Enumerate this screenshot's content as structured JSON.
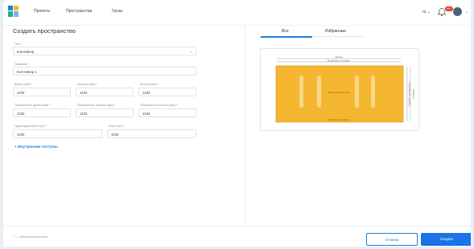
{
  "header": {
    "nav": [
      "Проекты",
      "Пространства",
      "Грузы"
    ],
    "lang": "ru",
    "notification_count": "99+"
  },
  "form": {
    "title": "Создать пространство",
    "type": {
      "label": "Тип",
      "value": "Контейнер"
    },
    "name": {
      "label": "Название",
      "value": "Контейнер 1"
    },
    "length": {
      "label": "Длина (мм)",
      "value": "1234"
    },
    "width": {
      "label": "Ширина (мм)",
      "value": "1234"
    },
    "height": {
      "label": "Высота (мм)",
      "value": "1234"
    },
    "length_error": {
      "label": "Погрешность длины (мм)",
      "value": "1234"
    },
    "width_error": {
      "label": "Погрешность ширины (мм)",
      "value": "1234"
    },
    "height_error": {
      "label": "Погрешность высоты (мм)",
      "value": "1234"
    },
    "capacity": {
      "label": "Грузоподъёмность (кг)",
      "value": "1234"
    },
    "mass": {
      "label": "Масса (кг)",
      "value": "1234"
    },
    "advanced": "Внутренние отступы"
  },
  "preview": {
    "tabs": [
      "Все",
      "Избранные"
    ],
    "dim_top": "Длина",
    "dim_top2": "Погрешность длины",
    "dim_right": "Ширина",
    "dim_right2": "Погрешность ширины",
    "center_label": "Внутренний отступ",
    "bottom_label": "Погрешность длины",
    "colors": {
      "container": "#f5b731",
      "container_border": "#e0a020",
      "rib": "#f8d98a"
    }
  },
  "footer": {
    "required_note": "— обязательное поле",
    "cancel": "Отмена",
    "create": "Создать"
  }
}
